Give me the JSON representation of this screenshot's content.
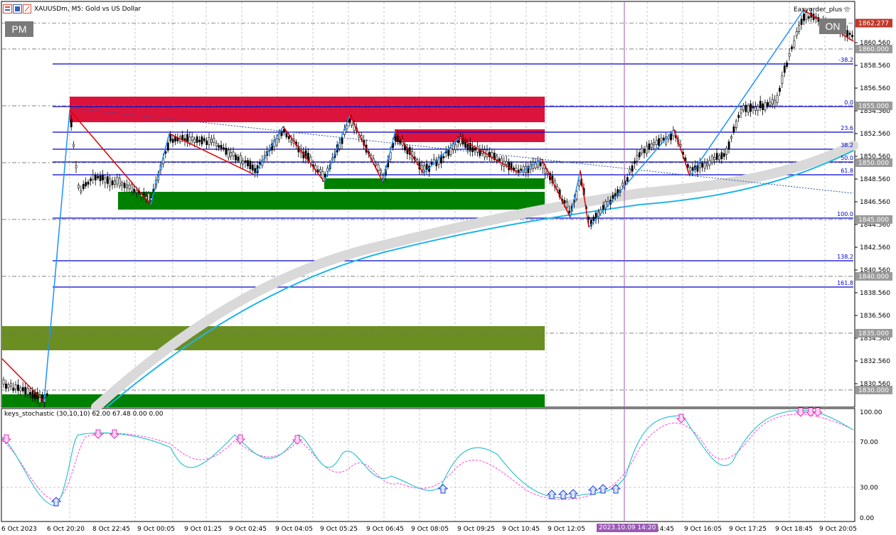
{
  "window": {
    "title": "XAUUSDm, M5:  Gold vs US Dollar",
    "symbol_icon": "chart-window-icon",
    "ea_name": "Easyorder_plus",
    "ea_icon": "graduation-hat-icon",
    "pm_label": "PM",
    "on_label": "ON"
  },
  "indicator": {
    "label": "keys_stochastic (30,10,10) 62.00 67.48 0.00 0.00"
  },
  "price_axis": {
    "labels": [
      "1860.560",
      "1858.560",
      "1856.560",
      "1854.560",
      "1852.560",
      "1850.560",
      "1848.560",
      "1846.560",
      "1844.560",
      "1842.560",
      "1840.560",
      "1838.560",
      "1836.560",
      "1834.560",
      "1832.560",
      "1830.560"
    ],
    "tags": [
      {
        "label": "1862.277",
        "color": "#c0392b"
      },
      {
        "label": "1860.000",
        "color": "#9a9a9a"
      },
      {
        "label": "1855.000",
        "color": "#9a9a9a"
      },
      {
        "label": "1850.000",
        "color": "#9a9a9a"
      },
      {
        "label": "1845.000",
        "color": "#9a9a9a"
      },
      {
        "label": "1840.000",
        "color": "#9a9a9a"
      },
      {
        "label": "1835.000",
        "color": "#9a9a9a"
      },
      {
        "label": "1830.000",
        "color": "#9a9a9a"
      }
    ]
  },
  "fib_levels": [
    "-38.2",
    "0.0",
    "23.6",
    "38.2",
    "50.0",
    "61.8",
    "100.0",
    "138.2",
    "161.8"
  ],
  "osc_axis": [
    "100.00",
    "70.00",
    "30.00",
    "0.00"
  ],
  "time_axis": [
    "6 Oct 2023",
    "6 Oct 20:20",
    "8 Oct 22:45",
    "9 Oct 00:05",
    "9 Oct 01:25",
    "9 Oct 02:45",
    "9 Oct 04:05",
    "9 Oct 05:25",
    "9 Oct 06:45",
    "9 Oct 08:05",
    "9 Oct 09:25",
    "9 Oct 10:45",
    "9 Oct 12:05",
    "9 Oct 14:45",
    "9 Oct 16:05",
    "9 Oct 17:25",
    "9 Oct 18:45",
    "9 Oct 20:05"
  ],
  "crosshair_time": "2023.10.09 14:20",
  "colors": {
    "supply_zone": "#dc143c",
    "demand_zone": "#008000",
    "olive_zone": "#6b8e23",
    "fib_line": "#0000cd",
    "zigzag_down": "#e00000",
    "zigzag_up": "#1e90ff",
    "ma_line": "#1fb5e8",
    "ma_band": "#d3d3d3",
    "stoch_main": "#33c4cc",
    "stoch_signal": "#ff44dd",
    "crosshair": "#9b59b6"
  }
}
